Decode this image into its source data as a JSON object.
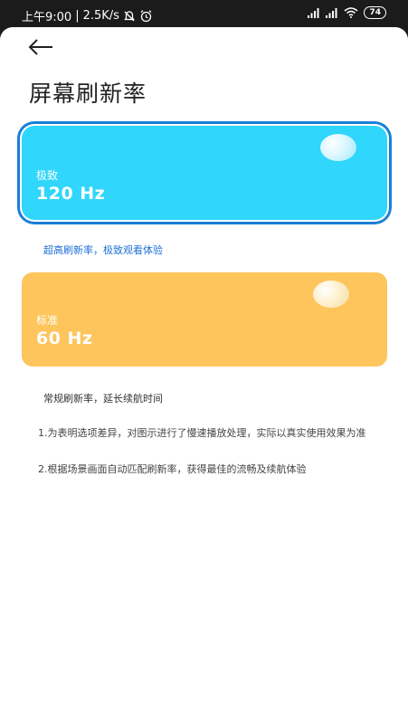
{
  "status_bar": {
    "time": "上午9:00",
    "network_speed": "2.5K/s",
    "battery": "74",
    "icons": [
      "mute-icon",
      "alarm-icon",
      "signal-icon",
      "signal-icon",
      "wifi-icon",
      "battery-icon"
    ]
  },
  "header": {
    "back_icon": "arrow-left-icon",
    "title": "屏幕刷新率"
  },
  "options": [
    {
      "label": "极致",
      "value": "120 Hz",
      "caption": "超高刷新率，极致观看体验",
      "color": "#30d6fb",
      "selected": true
    },
    {
      "label": "标准",
      "value": "60 Hz",
      "caption": "常规刷新率，延长续航时间",
      "color": "#fdc55c",
      "selected": false
    }
  ],
  "notes": [
    "1.为表明选项差异，对图示进行了慢速播放处理，实际以真实使用效果为准",
    "2.根据场景画面自动匹配刷新率，获得最佳的流畅及续航体验"
  ],
  "colors": {
    "selected_border": "#1a7fd6",
    "caption_selected": "#1d6fd6"
  }
}
